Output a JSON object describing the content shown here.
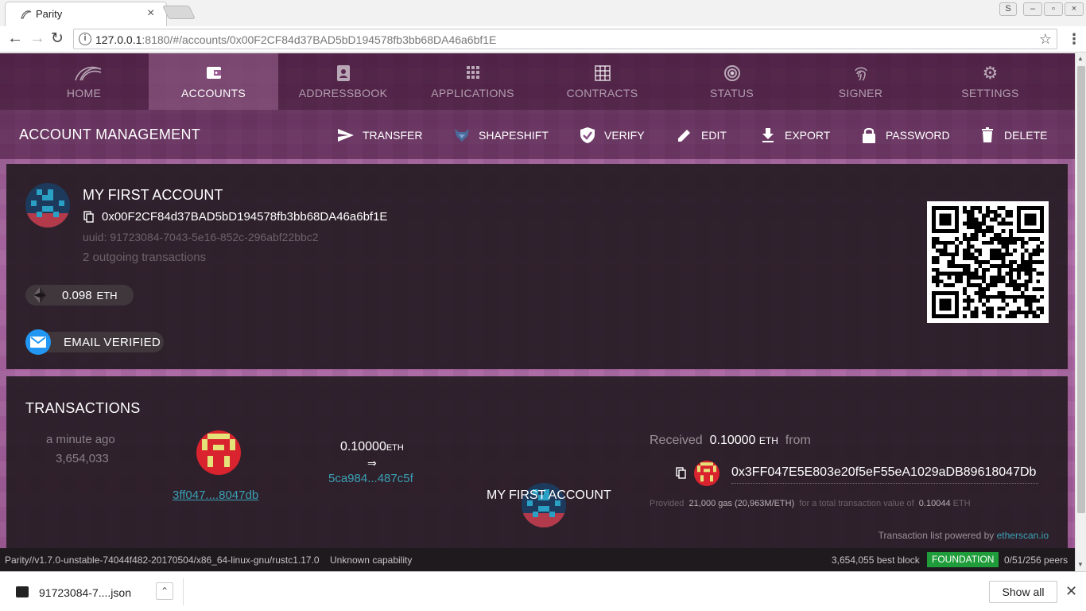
{
  "browser": {
    "tab_title": "Parity",
    "url_host": "127.0.0.1",
    "url_rest": ":8180/#/accounts/0x00F2CF84d37BAD5bD194578fb3bb68DA46a6bf1E"
  },
  "nav": {
    "items": [
      {
        "label": "HOME"
      },
      {
        "label": "ACCOUNTS"
      },
      {
        "label": "ADDRESSBOOK"
      },
      {
        "label": "APPLICATIONS"
      },
      {
        "label": "CONTRACTS"
      },
      {
        "label": "STATUS"
      },
      {
        "label": "SIGNER"
      },
      {
        "label": "SETTINGS"
      }
    ]
  },
  "actionbar": {
    "title": "ACCOUNT MANAGEMENT",
    "transfer": "TRANSFER",
    "shapeshift": "SHAPESHIFT",
    "verify": "VERIFY",
    "edit": "EDIT",
    "export": "EXPORT",
    "password": "PASSWORD",
    "delete": "DELETE"
  },
  "account": {
    "name": "MY FIRST ACCOUNT",
    "address": "0x00F2CF84d37BAD5bD194578fb3bb68DA46a6bf1E",
    "uuid": "uuid: 91723084-7043-5e16-852c-296abf22bbc2",
    "outgoing": "2 outgoing transactions",
    "balance": "0.098",
    "balance_unit": "ETH",
    "email_status": "EMAIL VERIFIED"
  },
  "transactions": {
    "heading": "TRANSACTIONS",
    "time": "a minute ago",
    "block": "3,654,033",
    "from_short": "3ff047....8047db",
    "amount": "0.10000",
    "amount_unit": "ETH",
    "arrow": "⇒",
    "hash_short": "5ca984...487c5f",
    "to_name": "MY FIRST ACCOUNT",
    "received_label": "Received",
    "received_value": "0.10000",
    "received_unit": "ETH",
    "received_from": "from",
    "from_address": "0x3FF047E5E803e20f5eF55eA1029aDB89618047Db",
    "provided_prefix": "Provided",
    "provided_gas": "21,000 gas (20,963M/ETH)",
    "provided_mid": "for a total transaction value of",
    "provided_total": "0.10044",
    "provided_unit": "ETH",
    "powered_prefix": "Transaction list powered by",
    "powered_link": "etherscan.io"
  },
  "statusbar": {
    "version": "Parity//v1.7.0-unstable-74044f482-20170504/x86_64-linux-gnu/rustc1.17.0",
    "capability": "Unknown capability",
    "best_block": "3,654,055 best block",
    "chain": "FOUNDATION",
    "peers": "0/51/256 peers"
  },
  "downloads": {
    "file_name": "91723084-7....json",
    "show_all": "Show all"
  },
  "colors": {
    "link": "#3aa0b4",
    "chain_badge": "#1f9d3a",
    "email_icon": "#2196f3"
  }
}
